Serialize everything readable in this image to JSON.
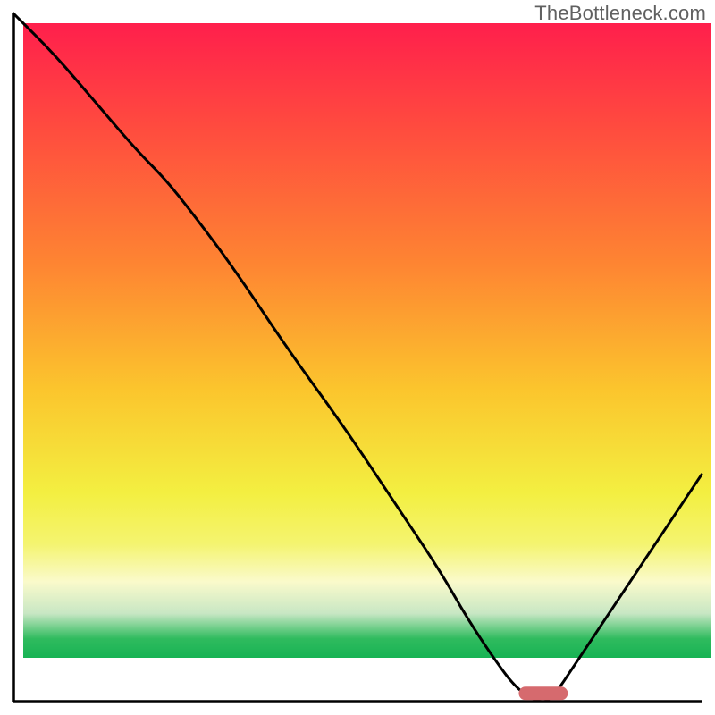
{
  "watermark": {
    "text": "TheBottleneck.com"
  },
  "colors": {
    "axis": "#000000",
    "curve": "#000000",
    "markerFill": "#d66a6e",
    "markerStroke": "#d66a6e"
  },
  "chart_data": {
    "type": "line",
    "title": "",
    "xlabel": "",
    "ylabel": "",
    "xlim": [
      0,
      100
    ],
    "ylim": [
      0,
      100
    ],
    "grid": false,
    "annotations": [
      "TheBottleneck.com"
    ],
    "background_gradient": "red-to-green vertical",
    "series": [
      {
        "name": "bottleneck-curve",
        "x": [
          0,
          6,
          12,
          18,
          22,
          26,
          32,
          40,
          48,
          56,
          62,
          66,
          70,
          73,
          76,
          78,
          82,
          88,
          94,
          100
        ],
        "y": [
          100,
          94,
          87,
          80,
          76,
          71,
          63,
          51,
          40,
          28,
          19,
          12,
          6,
          2,
          0,
          0,
          6,
          15,
          24,
          33
        ]
      }
    ],
    "marker_region": {
      "x_start": 73.5,
      "x_end": 80.5,
      "y": 1.2
    },
    "notes": "y read as percentage of full height; values estimated from pixel positions"
  },
  "geometry": {
    "plot_left": 15,
    "plot_right": 785,
    "plot_top": 15,
    "baseline_y": 785
  }
}
